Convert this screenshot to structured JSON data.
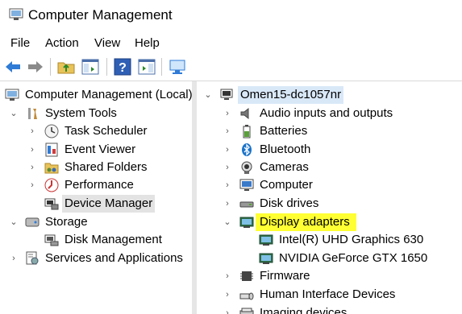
{
  "window": {
    "title": "Computer Management"
  },
  "menu": {
    "items": [
      "File",
      "Action",
      "View",
      "Help"
    ]
  },
  "toolbar": {
    "buttons": [
      "back-icon",
      "forward-icon",
      "up-folder-icon",
      "show-hide-tree-icon",
      "help-icon",
      "properties-panel-icon",
      "monitor-icon"
    ]
  },
  "left_tree": {
    "root": "Computer Management (Local)",
    "system_tools": "System Tools",
    "task_scheduler": "Task Scheduler",
    "event_viewer": "Event Viewer",
    "shared_folders": "Shared Folders",
    "performance": "Performance",
    "device_manager": "Device Manager",
    "storage": "Storage",
    "disk_management": "Disk Management",
    "services": "Services and Applications"
  },
  "right_tree": {
    "computer_name": "Omen15-dc1057nr",
    "categories": {
      "audio": "Audio inputs and outputs",
      "batteries": "Batteries",
      "bluetooth": "Bluetooth",
      "cameras": "Cameras",
      "computer": "Computer",
      "disk_drives": "Disk drives",
      "display_adapters": "Display adapters",
      "firmware": "Firmware",
      "hid": "Human Interface Devices",
      "imaging": "Imaging devices"
    },
    "display_children": [
      "Intel(R) UHD Graphics 630",
      "NVIDIA GeForce GTX 1650"
    ]
  },
  "colors": {
    "highlight": "#ffff33",
    "selection": "#e3e3e3",
    "accent": "#1a73c9"
  }
}
